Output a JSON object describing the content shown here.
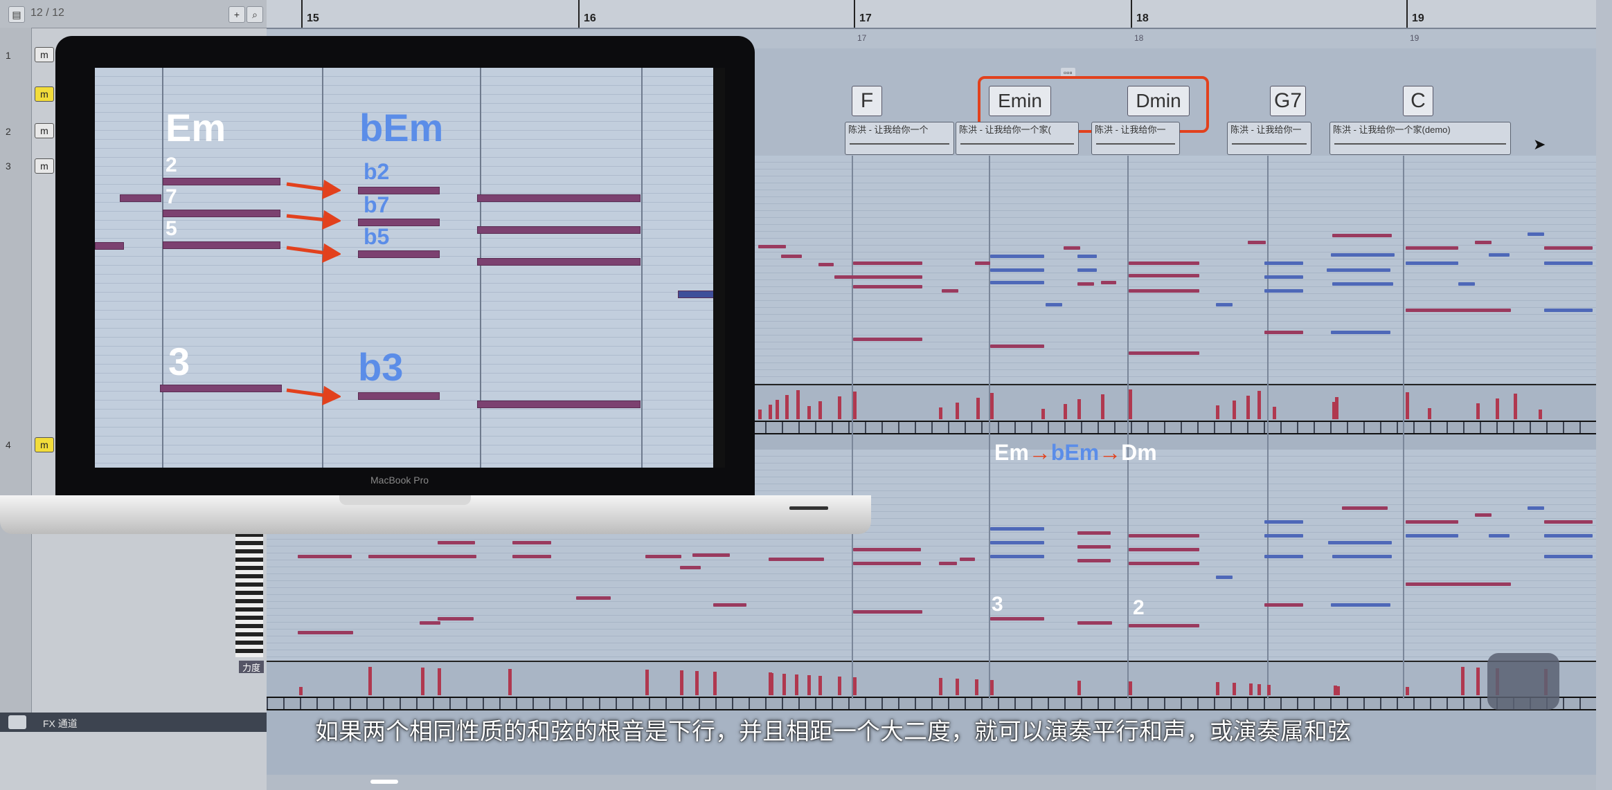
{
  "inspector": {
    "track_count": "12 / 12",
    "fx_channel": "FX 通道",
    "velocity_label": "力度",
    "track_numbers": [
      "1",
      "2",
      "3",
      "4"
    ],
    "mute_label": "m"
  },
  "ruler": {
    "bars": [
      "15",
      "16",
      "17",
      "18",
      "19"
    ],
    "sub_marks": [
      "17",
      "18",
      "19"
    ]
  },
  "chords": {
    "items": [
      "F",
      "Emin",
      "Dmin",
      "G7",
      "C"
    ]
  },
  "clips": [
    "陈洪 - 让我给你一个",
    "陈洪 - 让我给你一个家(",
    "陈洪 - 让我给你一",
    "陈洪 - 让我给你一",
    "陈洪 - 让我给你一个家(demo)"
  ],
  "laptop": {
    "brand": "MacBook Pro",
    "chord_left": "Em",
    "chord_right": "bEm",
    "intervals_left": [
      "2",
      "7",
      "5"
    ],
    "intervals_right": [
      "b2",
      "b7",
      "b5"
    ],
    "root_left": "3",
    "root_right": "b3"
  },
  "annotations": {
    "seq_a": "Em",
    "seq_b": "bEm",
    "seq_c": "Dm",
    "arrow": "→",
    "mark_3": "3",
    "mark_2": "2"
  },
  "caption": "如果两个相同性质的和弦的根音是下行，并且相距一个大二度，就可以演奏平行和声，或演奏属和弦",
  "colors": {
    "highlight": "#e2411d",
    "chord_white": "#ffffff",
    "chord_blue": "#5b8de8",
    "note_red": "#9a3a5e",
    "note_blue": "#4e68b8"
  }
}
